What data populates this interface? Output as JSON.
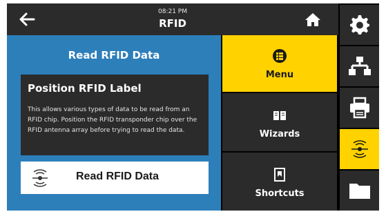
{
  "header": {
    "time": "08:21 PM",
    "title": "RFID"
  },
  "panel": {
    "title": "Read RFID Data",
    "info_title": "Position RFID Label",
    "info_text": "This allows various types of data to be read from an RFID chip. Position the RFID transponder chip over the RFID antenna array before trying to read the data.",
    "action_label": "Read RFID Data"
  },
  "menu": {
    "items": [
      {
        "label": "Menu",
        "icon": "menu-icon",
        "active": true
      },
      {
        "label": "Wizards",
        "icon": "book-icon",
        "active": false
      },
      {
        "label": "Shortcuts",
        "icon": "bookmark-icon",
        "active": false
      }
    ]
  },
  "sidebar": {
    "items": [
      {
        "icon": "gear-icon",
        "active": false
      },
      {
        "icon": "network-icon",
        "active": false
      },
      {
        "icon": "printer-icon",
        "active": false
      },
      {
        "icon": "rfid-icon",
        "active": true
      },
      {
        "icon": "folder-icon",
        "active": false
      }
    ]
  },
  "colors": {
    "accent": "#ffd200",
    "panel_blue": "#2d7fba",
    "dark": "#2b2b2b"
  }
}
